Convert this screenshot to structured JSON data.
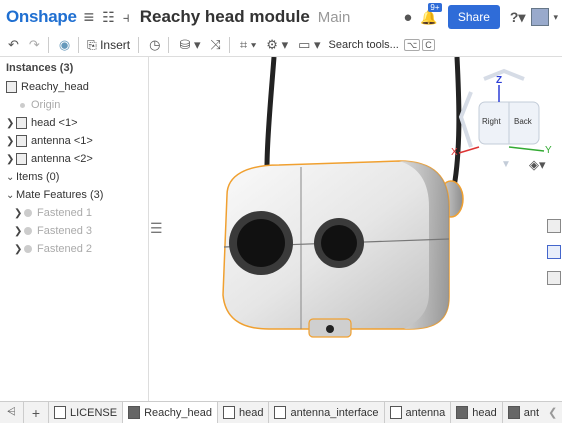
{
  "header": {
    "logo": "Onshape",
    "document_title": "Reachy head module",
    "workspace": "Main",
    "notifications_badge": "9+",
    "share_label": "Share"
  },
  "toolbar": {
    "insert_label": "Insert",
    "search_label": "Search tools...",
    "search_shortcut_1": "⌥",
    "search_shortcut_2": "C"
  },
  "instances": {
    "header": "Instances (3)",
    "items": [
      {
        "label": "Reachy_head"
      },
      {
        "label": "Origin"
      },
      {
        "label": "head <1>"
      },
      {
        "label": "antenna <1>"
      },
      {
        "label": "antenna <2>"
      },
      {
        "label": "Items (0)"
      },
      {
        "label": "Mate Features (3)"
      },
      {
        "label": "Fastened 1"
      },
      {
        "label": "Fastened 3"
      },
      {
        "label": "Fastened 2"
      }
    ]
  },
  "view_cube": {
    "top": "Z",
    "front": "Right",
    "side": "Back",
    "x_axis": "X",
    "y_axis": "Y"
  },
  "bottom_tabs": [
    {
      "label": "LICENSE"
    },
    {
      "label": "Reachy_head"
    },
    {
      "label": "head"
    },
    {
      "label": "antenna_interface"
    },
    {
      "label": "antenna"
    },
    {
      "label": "head"
    },
    {
      "label": "ant"
    }
  ],
  "colors": {
    "brand": "#1f6fd1",
    "share_button": "#2f6cd8",
    "selection_outline": "#f0a030"
  }
}
